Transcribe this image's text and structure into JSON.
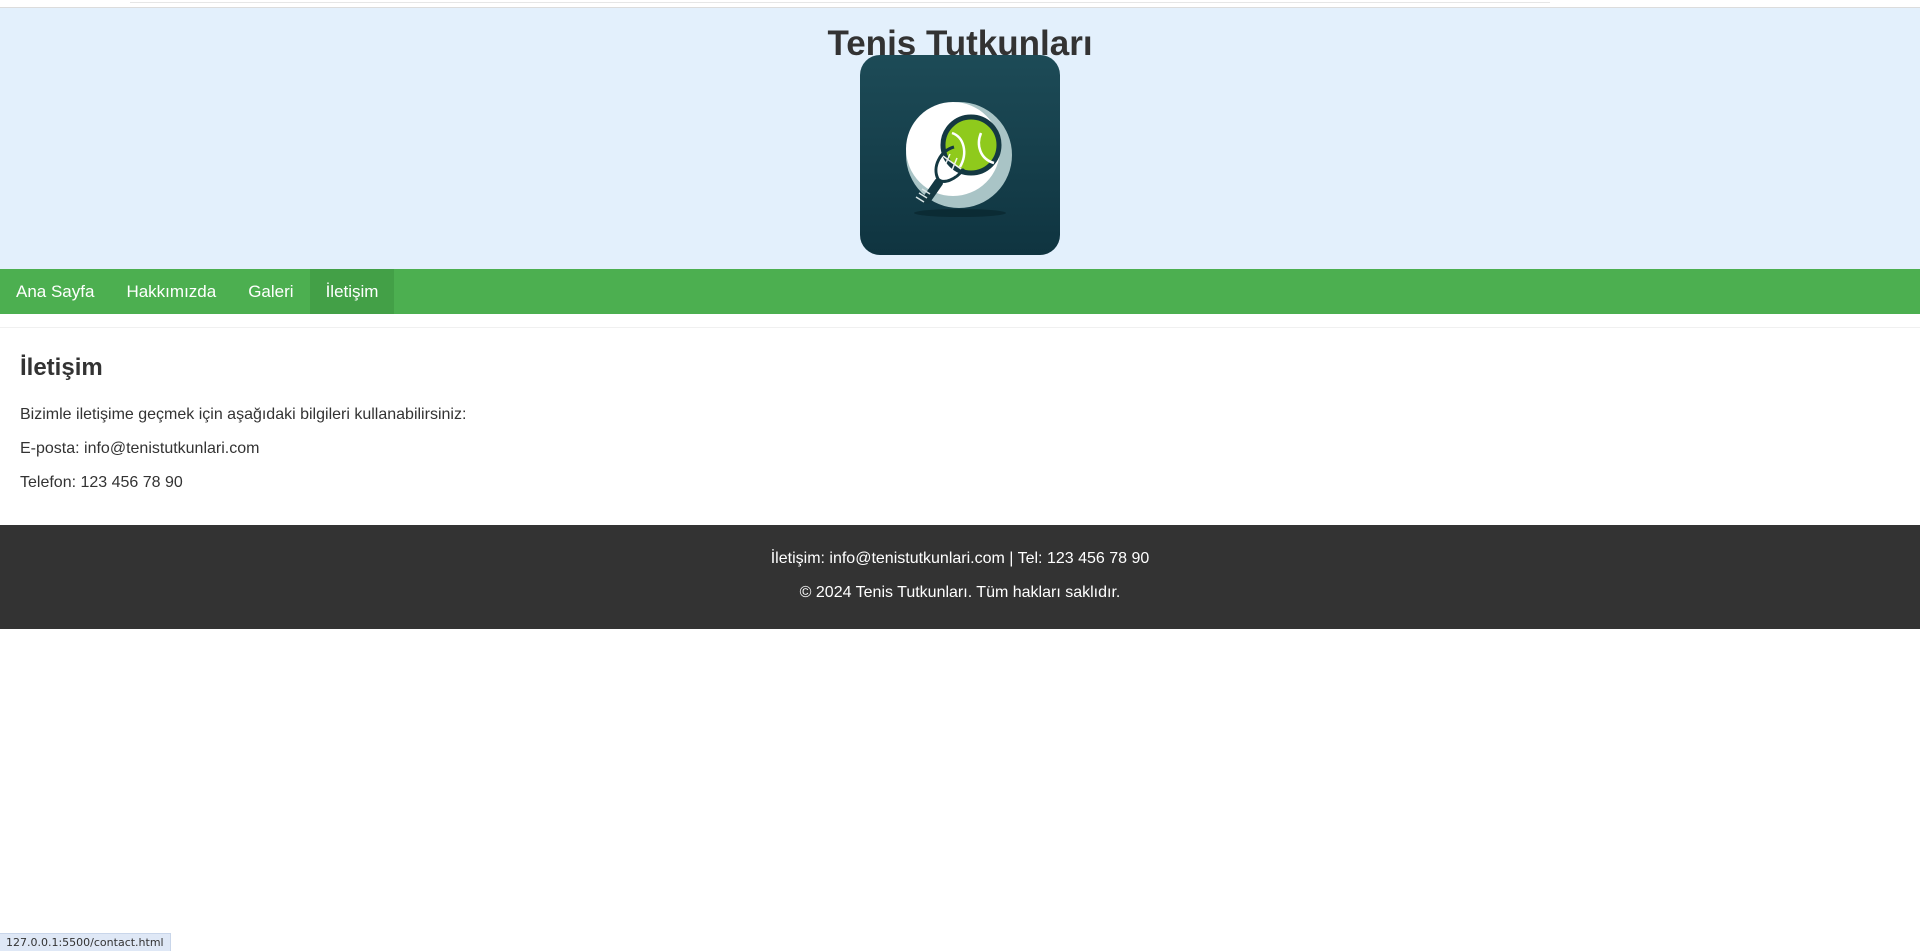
{
  "header": {
    "title": "Tenis Tutkunları",
    "logo_icon": "tennis-racket-ball-icon"
  },
  "nav": {
    "items": [
      {
        "label": "Ana Sayfa",
        "active": false
      },
      {
        "label": "Hakkımızda",
        "active": false
      },
      {
        "label": "Galeri",
        "active": false
      },
      {
        "label": "İletişim",
        "active": true
      }
    ]
  },
  "main": {
    "heading": "İletişim",
    "intro": "Bizimle iletişime geçmek için aşağıdaki bilgileri kullanabilirsiniz:",
    "email": "E-posta: info@tenistutkunlari.com",
    "phone": "Telefon: 123 456 78 90"
  },
  "footer": {
    "contact": "İletişim: info@tenistutkunlari.com | Tel: 123 456 78 90",
    "copyright": "© 2024 Tenis Tutkunları. Tüm hakları saklıdır."
  },
  "status_bar": {
    "url": "127.0.0.1:5500/contact.html"
  },
  "colors": {
    "header_bg": "#e3f0fc",
    "nav_bg": "#4caf50",
    "nav_active_bg": "#43a047",
    "footer_bg": "#333333",
    "logo_bg": "#13404b",
    "ball_green": "#8fca1c"
  }
}
